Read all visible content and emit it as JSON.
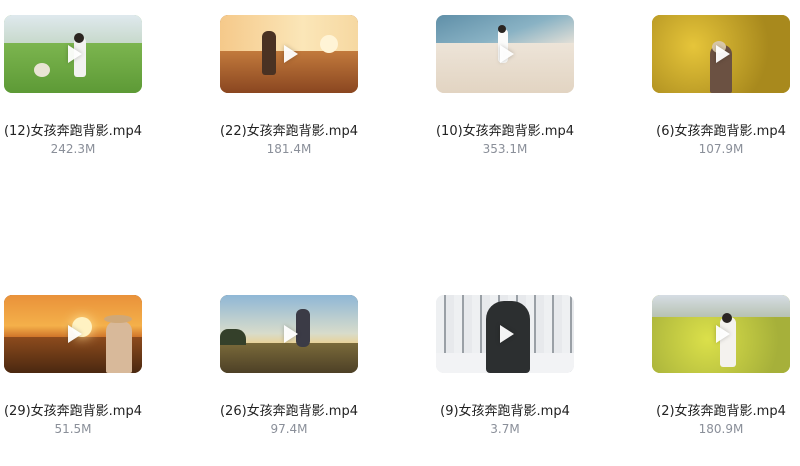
{
  "files": [
    {
      "name": "(12)女孩奔跑背影.mp4",
      "size": "242.3M",
      "thumbnail_icon": "video-thumbnail-field-girl"
    },
    {
      "name": "(22)女孩奔跑背影.mp4",
      "size": "181.4M",
      "thumbnail_icon": "video-thumbnail-sunset-field"
    },
    {
      "name": "(10)女孩奔跑背影.mp4",
      "size": "353.1M",
      "thumbnail_icon": "video-thumbnail-beach-girl"
    },
    {
      "name": "(6)女孩奔跑背影.mp4",
      "size": "107.9M",
      "thumbnail_icon": "video-thumbnail-rapeseed-girl"
    },
    {
      "name": "(29)女孩奔跑背影.mp4",
      "size": "51.5M",
      "thumbnail_icon": "video-thumbnail-sunset-hat-girl"
    },
    {
      "name": "(26)女孩奔跑背影.mp4",
      "size": "97.4M",
      "thumbnail_icon": "video-thumbnail-jumping-girl"
    },
    {
      "name": "(9)女孩奔跑背影.mp4",
      "size": "3.7M",
      "thumbnail_icon": "video-thumbnail-snow-forest"
    },
    {
      "name": "(2)女孩奔跑背影.mp4",
      "size": "180.9M",
      "thumbnail_icon": "video-thumbnail-flower-field"
    }
  ],
  "play_icon": "play-icon"
}
